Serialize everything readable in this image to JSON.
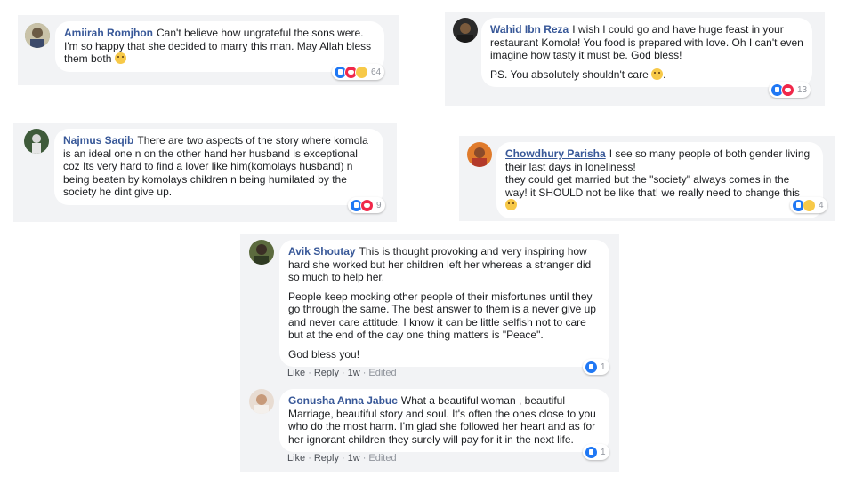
{
  "comments": [
    {
      "name": "Amiirah Romjhon",
      "paragraphs": [
        "Can't believe how ungrateful the sons were. I'm so happy that she decided to marry this man. May Allah bless them both"
      ],
      "emoji": "smiling-face-emoji",
      "reactions": [
        "like",
        "love",
        "sad"
      ],
      "reaction_count": "64"
    },
    {
      "name": "Wahid Ibn Reza",
      "paragraphs": [
        "I wish I could go and have huge feast in your restaurant Komola! You food is prepared with love. Oh I can't even imagine how tasty it must be. God bless!",
        "PS. You absolutely shouldn't care"
      ],
      "emoji": "smiling-face-emoji",
      "reactions": [
        "like",
        "love"
      ],
      "reaction_count": "13"
    },
    {
      "name": "Najmus Saqib",
      "paragraphs": [
        "There are two aspects of the story where komola is an ideal one n on the other hand her husband is exceptional coz Its very hard to find a lover like him(komolays husband) n being beaten by komolays children n being humilated by the society he dint give up."
      ],
      "reactions": [
        "like",
        "love"
      ],
      "reaction_count": "9"
    },
    {
      "name": "Chowdhury Parisha",
      "paragraphs": [
        "I see so many people of both gender living their last days in loneliness!",
        "they could get married but the \"society\" always comes in the way! it SHOULD not be like that! we really need to change this"
      ],
      "emoji": "worried-face-emoji",
      "reactions": [
        "like",
        "wow"
      ],
      "reaction_count": "4"
    },
    {
      "name": "Avik Shoutay",
      "paragraphs": [
        "This is thought provoking and very inspiring how hard she worked but her children left her whereas a stranger did so much to help her.",
        "People keep mocking other people of their misfortunes until they go through the same. The best answer to them is a never give up and never care attitude. I know it can be little selfish not to care but at the end of the day one thing matters is \"Peace\".",
        "God bless you!"
      ],
      "reactions": [
        "like"
      ],
      "reaction_count": "1",
      "actions": {
        "like": "Like",
        "reply": "Reply",
        "time": "1w",
        "edited": "Edited"
      }
    },
    {
      "name": "Gonusha Anna Jabuc",
      "paragraphs": [
        "What a beautiful woman , beautiful Marriage, beautiful story and soul. It's often the ones close to you who do the most harm. I'm glad she followed her heart and as for her ignorant children they surely will pay for it in the next life."
      ],
      "reactions": [
        "like"
      ],
      "reaction_count": "1",
      "actions": {
        "like": "Like",
        "reply": "Reply",
        "time": "1w",
        "edited": "Edited"
      }
    }
  ],
  "separator": "·",
  "colors": {
    "name_link": "#385898",
    "panel_bg": "#f2f3f5",
    "like": "#2078f4",
    "love": "#f0284a"
  }
}
